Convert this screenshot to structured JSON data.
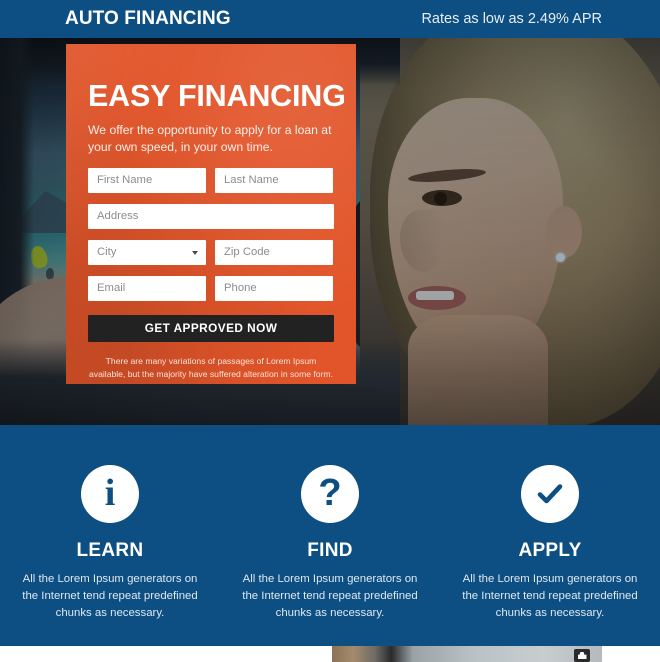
{
  "header": {
    "logo": "AUTO FINANCING",
    "tagline": "Rates as low as 2.49% APR",
    "background_color": "#0d4f82"
  },
  "hero": {
    "description": "Woman driving a convertible car along a coastal road, blue tinted photograph"
  },
  "form": {
    "heading": "EASY FINANCING",
    "subheading": "We offer the opportunity to apply for a loan at your own speed, in your own time.",
    "panel_color": "#e2552a",
    "fields": [
      {
        "name": "first-name",
        "placeholder": "First Name",
        "value": "",
        "type": "text"
      },
      {
        "name": "last-name",
        "placeholder": "Last Name",
        "value": "",
        "type": "text"
      },
      {
        "name": "address",
        "placeholder": "Address",
        "value": "",
        "type": "text"
      },
      {
        "name": "city",
        "placeholder": "City",
        "value": "",
        "type": "select"
      },
      {
        "name": "zip-code",
        "placeholder": "Zip Code",
        "value": "",
        "type": "text"
      },
      {
        "name": "email",
        "placeholder": "Email",
        "value": "",
        "type": "text"
      },
      {
        "name": "phone",
        "placeholder": "Phone",
        "value": "",
        "type": "text"
      }
    ],
    "submit_label": "GET APPROVED NOW",
    "submit_color": "#222222",
    "note": "There are many variations of passages of Lorem Ipsum available, but the majority have suffered alteration in some form."
  },
  "features": {
    "background_color": "#0d4f82",
    "items": [
      {
        "icon": "info-icon",
        "glyph": "i",
        "title": "LEARN",
        "description": "All the Lorem Ipsum generators on the Internet tend repeat predefined chunks as necessary."
      },
      {
        "icon": "question-mark-icon",
        "glyph": "?",
        "title": "FIND",
        "description": "All the Lorem Ipsum generators on the Internet tend repeat predefined chunks as necessary."
      },
      {
        "icon": "checkmark-icon",
        "glyph": "✔",
        "title": "APPLY",
        "description": "All the Lorem Ipsum generators on the Internet tend repeat predefined chunks as necessary."
      }
    ]
  },
  "bottom": {
    "description": "Partially visible next section image strip with a dark badge icon"
  }
}
